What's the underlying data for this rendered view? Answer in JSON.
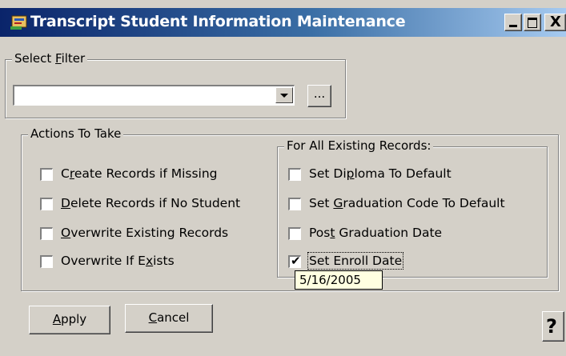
{
  "window": {
    "title": "Transcript Student Information Maintenance",
    "controls": {
      "minimize": "_",
      "maximize": "□",
      "close": "X"
    }
  },
  "select_filter": {
    "legend": "Select Filter",
    "legend_accel": "F",
    "combo_value": "",
    "browse_label": "..."
  },
  "actions": {
    "legend": "Actions To Take",
    "items": [
      {
        "label": "Create Records if Missing",
        "accel": "r",
        "checked": false
      },
      {
        "label": "Delete Records if No Student",
        "accel": "D",
        "checked": false
      },
      {
        "label": "Overwrite Existing Records",
        "accel": "O",
        "checked": false
      },
      {
        "label": "Overwrite If Exists",
        "accel": "x",
        "checked": false
      }
    ]
  },
  "existing": {
    "legend": "For All Existing Records:",
    "items": [
      {
        "label": "Set Diploma To Default",
        "accel": "p",
        "checked": false
      },
      {
        "label": "Set Graduation Code To Default",
        "accel": "G",
        "checked": false
      },
      {
        "label": "Post Graduation Date",
        "accel": "t",
        "checked": false
      },
      {
        "label": "Set Enroll Date",
        "accel": "",
        "checked": true
      }
    ]
  },
  "tooltip": {
    "text": "5/16/2005"
  },
  "buttons": {
    "apply": "Apply",
    "apply_accel": "A",
    "cancel": "Cancel",
    "cancel_accel": "C",
    "help": "?"
  },
  "colors": {
    "face": "#d4d0c8",
    "title_start": "#0a246a",
    "title_end": "#a6caf0",
    "tooltip": "#ffffe1"
  },
  "icons": {
    "app": "transcript-app-icon",
    "help": "help-question-icon"
  }
}
